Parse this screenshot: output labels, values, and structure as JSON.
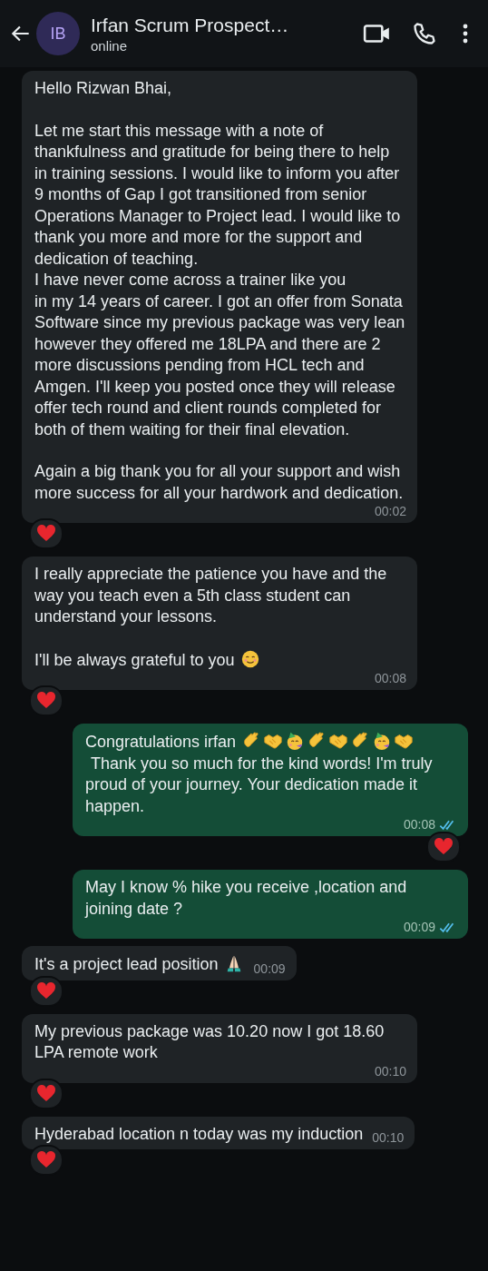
{
  "header": {
    "avatar": "IB",
    "title": "Irfan Scrum Prospect…",
    "status": "online"
  },
  "messages": [
    {
      "kind": "incoming",
      "paragraphs": [
        [
          {
            "kind": "text",
            "text": "Hello Rizwan Bhai,"
          }
        ],
        [
          {
            "kind": "text",
            "text": "Let me start this message with a note of thankfulness and gratitude for being there to help in training sessions. I would like to inform you after 9 months of Gap I got transitioned from senior Operations Manager to Project lead. I would like to thank you more and more for the support and dedication of teaching.\nI have never come across a trainer like you\nin my 14 years of career. I got an offer from Sonata Software since my previous package was very lean however they offered me 18LPA and there are 2 more discussions pending from HCL tech and Amgen. I'll keep you posted once they will release offer tech round and client rounds completed for both of them waiting for their final elevation."
          }
        ],
        [
          {
            "kind": "text",
            "text": "Again a big thank you for all your support and wish more success for all your hardwork and dedication."
          }
        ]
      ],
      "time": "00:02",
      "reaction": true
    },
    {
      "kind": "incoming",
      "paragraphs": [
        [
          {
            "kind": "text",
            "text": "I really appreciate the patience you have and the way you teach even a 5th class student can understand your lessons."
          }
        ],
        [
          {
            "kind": "text",
            "text": "I'll be always grateful to you"
          },
          {
            "kind": "smile"
          }
        ]
      ],
      "time": "00:08",
      "reaction": true
    },
    {
      "kind": "outgoing",
      "paragraphs": [
        [
          {
            "kind": "text",
            "text": "Congratulations irfan"
          },
          {
            "kind": "clap"
          },
          {
            "kind": "handshake"
          },
          {
            "kind": "party"
          },
          {
            "kind": "clap"
          },
          {
            "kind": "handshake"
          },
          {
            "kind": "clap"
          },
          {
            "kind": "party"
          },
          {
            "kind": "handshake"
          },
          {
            "kind": "text",
            "text": "Thank you so much for the kind words! I'm truly proud of your journey. Your dedication made it happen."
          }
        ]
      ],
      "time": "00:08",
      "read": true,
      "reaction": true
    },
    {
      "kind": "outgoing",
      "paragraphs": [
        [
          {
            "kind": "text",
            "text": "May I know % hike you receive ,location and joining date ?"
          }
        ]
      ],
      "time": "00:09",
      "read": true,
      "reaction": false
    },
    {
      "kind": "incoming",
      "paragraphs": [
        [
          {
            "kind": "text",
            "text": "It's a project lead position"
          },
          {
            "kind": "pray"
          }
        ]
      ],
      "time": "00:09",
      "reaction": true
    },
    {
      "kind": "incoming",
      "paragraphs": [
        [
          {
            "kind": "text",
            "text": "My previous package was 10.20 now I got 18.60 LPA remote work"
          }
        ]
      ],
      "time": "00:10",
      "reaction": true
    },
    {
      "kind": "incoming",
      "paragraphs": [
        [
          {
            "kind": "text",
            "text": "Hyderabad location n today was my induction"
          }
        ]
      ],
      "time": "00:10",
      "reaction": true
    }
  ]
}
